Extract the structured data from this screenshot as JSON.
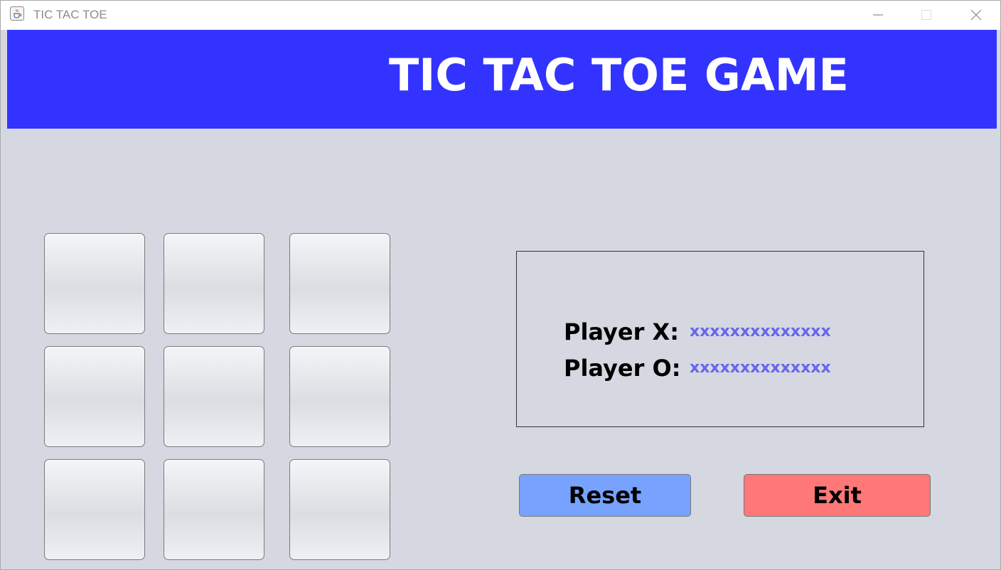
{
  "window": {
    "title": "TIC TAC TOE"
  },
  "banner": {
    "title": "TIC TAC TOE GAME",
    "background": "#3333ff"
  },
  "board": {
    "cells": [
      "",
      "",
      "",
      "",
      "",
      "",
      "",
      "",
      ""
    ]
  },
  "scoreboard": {
    "player_x_label": "Player X:",
    "player_x_value": "xxxxxxxxxxxxxx",
    "player_o_label": "Player O:",
    "player_o_value": "xxxxxxxxxxxxxx",
    "value_color": "#6666ee"
  },
  "actions": {
    "reset_label": "Reset",
    "reset_color": "#77a3ff",
    "exit_label": "Exit",
    "exit_color": "#ff7878"
  },
  "icons": {
    "app": "java-cup-icon",
    "minimize": "minimize-icon",
    "maximize": "maximize-icon",
    "close": "close-icon"
  }
}
